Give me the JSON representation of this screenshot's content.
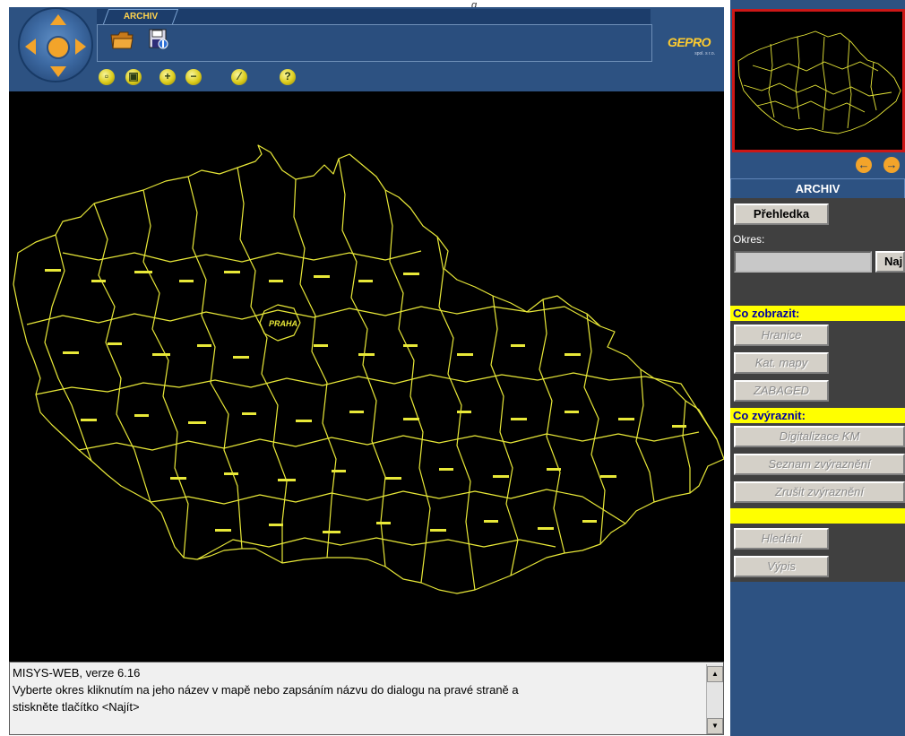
{
  "small_marker": "q",
  "tabs": [
    {
      "label": "ARCHIV"
    }
  ],
  "toolbar": {
    "icons": [
      "folder-icon",
      "save-disk-icon",
      "zoom-window-icon",
      "zoom-full-icon",
      "zoom-in-icon",
      "zoom-out-icon",
      "erase-icon",
      "help-icon"
    ],
    "zoom_in_glyph": "+",
    "zoom_out_glyph": "−",
    "help_glyph": "?"
  },
  "logo": {
    "text": "GEPRO",
    "sub": "spol. s r.o."
  },
  "status": {
    "lines": [
      "MISYS-WEB, verze 6.16",
      "Vyberte okres kliknutím na jeho název v mapě nebo zapsáním názvu do dialogu na pravé straně a",
      "stiskněte tlačítko <Najít>"
    ]
  },
  "right_panel": {
    "overview_nav": {
      "left": "←",
      "right": "→"
    },
    "title": "ARCHIV",
    "prehledka": "Přehledka",
    "okres_label": "Okres:",
    "najit": "Najít",
    "co_zobrazit": "Co zobrazit:",
    "hranice": "Hranice",
    "kat_mapy": "Kat. mapy",
    "zabaged": "ZABAGED",
    "co_zvyraznit": "Co zvýraznit:",
    "digitalizace_km": "Digitalizace KM",
    "seznam_zvyrazneni": "Seznam zvýraznění",
    "zrusit_zvyrazneni": "Zrušit zvýraznění",
    "hledani": "Hledání",
    "vypis": "Výpis"
  },
  "map": {
    "highlighted_label": "PRAHA",
    "line_color": "#e8e838",
    "background": "#000000"
  },
  "colors": {
    "panel_blue": "#2d5282",
    "accent_yellow": "#ffff00",
    "arrow_orange": "#f3a42a",
    "overview_border": "#cc1717"
  }
}
